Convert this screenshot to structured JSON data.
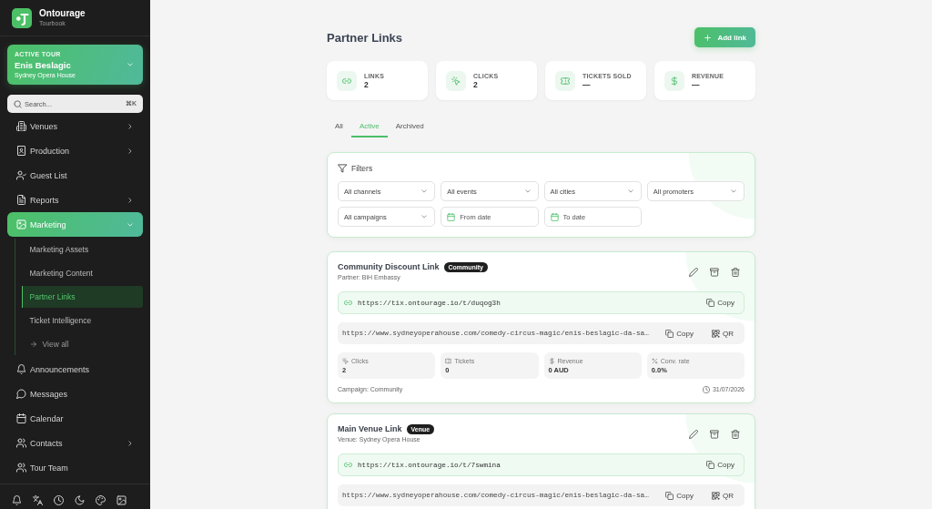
{
  "sidebar": {
    "brand": {
      "name": "Ontourage",
      "subtitle": "Tourbook"
    },
    "active_tour": {
      "label": "ACTIVE TOUR",
      "name": "Enis Beslagic",
      "venue": "Sydney Opera House"
    },
    "search": {
      "placeholder": "Search...",
      "shortcut": "⌘K"
    },
    "items": [
      {
        "label": "Venues",
        "kind": "group",
        "expanded": false,
        "selected": false
      },
      {
        "label": "Production",
        "kind": "group",
        "expanded": false,
        "selected": false
      },
      {
        "label": "Guest List",
        "kind": "link",
        "selected": false
      },
      {
        "label": "Reports",
        "kind": "group",
        "expanded": false,
        "selected": false
      },
      {
        "label": "Marketing",
        "kind": "group",
        "expanded": true,
        "selected": true,
        "children": [
          {
            "label": "Marketing Assets",
            "kind": "page",
            "selected": false
          },
          {
            "label": "Marketing Content",
            "kind": "page",
            "selected": false
          },
          {
            "label": "Partner Links",
            "kind": "page",
            "selected": true
          },
          {
            "label": "Ticket Intelligence",
            "kind": "page",
            "selected": false
          },
          {
            "label": "View all",
            "kind": "more",
            "selected": false
          }
        ]
      },
      {
        "label": "Announcements",
        "kind": "link",
        "selected": false
      },
      {
        "label": "Messages",
        "kind": "link",
        "selected": false
      },
      {
        "label": "Calendar",
        "kind": "link",
        "selected": false
      },
      {
        "label": "Contacts",
        "kind": "group",
        "expanded": false,
        "selected": false
      },
      {
        "label": "Tour Team",
        "kind": "link",
        "selected": false
      }
    ]
  },
  "header": {
    "title": "Partner Links",
    "add_button": "Add link"
  },
  "stats": [
    {
      "label": "LINKS",
      "value": "2"
    },
    {
      "label": "CLICKS",
      "value": "2"
    },
    {
      "label": "TICKETS SOLD",
      "value": "—"
    },
    {
      "label": "REVENUE",
      "value": "—"
    }
  ],
  "tabs": [
    {
      "label": "All",
      "selected": false
    },
    {
      "label": "Active",
      "selected": true
    },
    {
      "label": "Archived",
      "selected": false
    }
  ],
  "filters": {
    "title": "Filters",
    "fields": [
      {
        "kind": "select",
        "value": "All channels"
      },
      {
        "kind": "select",
        "value": "All events"
      },
      {
        "kind": "select",
        "value": "All cities"
      },
      {
        "kind": "select",
        "value": "All promoters"
      },
      {
        "kind": "select",
        "value": "All campaigns"
      },
      {
        "kind": "date",
        "placeholder": "From date"
      },
      {
        "kind": "date",
        "placeholder": "To date"
      }
    ]
  },
  "links": [
    {
      "title": "Community Discount Link",
      "tag": "Community",
      "subtitle": "Partner: BiH Embassy",
      "short_url": "https://tix.ontourage.io/t/duqog3h",
      "short_copy": "Copy",
      "full_url": "https://www.sydneyoperahouse.com/comedy-circus-magic/enis-beslagic-da-sa…",
      "full_copy": "Copy",
      "qr": "QR",
      "metrics": [
        {
          "label": "Clicks",
          "value": "2"
        },
        {
          "label": "Tickets",
          "value": "0"
        },
        {
          "label": "Revenue",
          "value": "0 AUD"
        },
        {
          "label": "Conv. rate",
          "value": "0.0%"
        }
      ],
      "campaign": "Campaign: Community",
      "date": "31/07/2026"
    },
    {
      "title": "Main Venue Link",
      "tag": "Venue",
      "subtitle": "Venue: Sydney Opera House",
      "short_url": "https://tix.ontourage.io/t/7swmina",
      "short_copy": "Copy",
      "full_url": "https://www.sydneyoperahouse.com/comedy-circus-magic/enis-beslagic-da-sa…",
      "full_copy": "Copy",
      "qr": "QR"
    }
  ]
}
